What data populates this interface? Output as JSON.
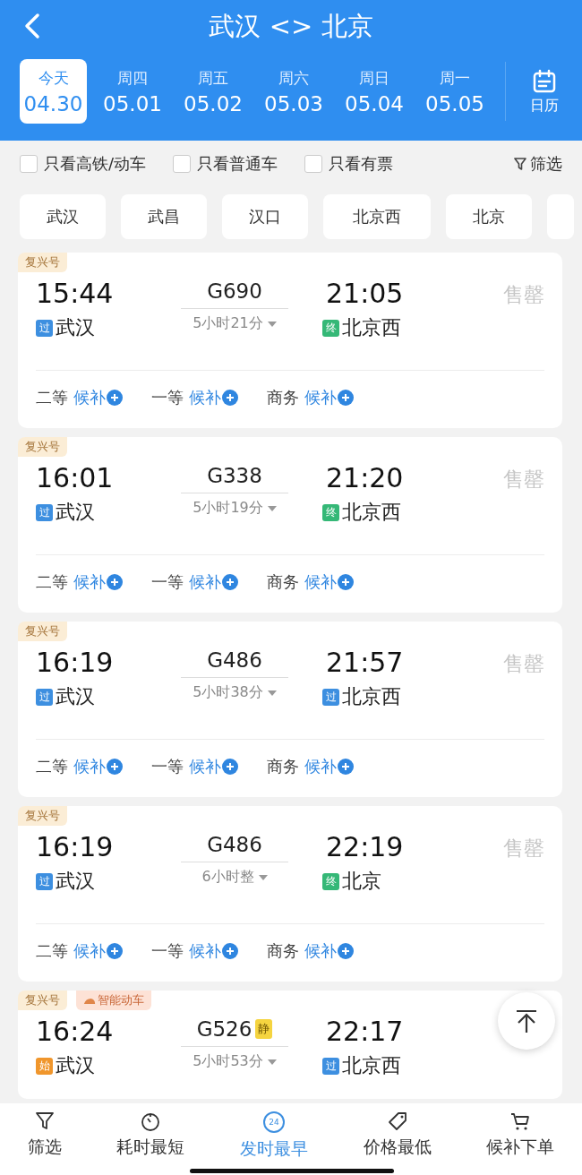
{
  "header": {
    "title": "武汉 <> 北京"
  },
  "dates": [
    {
      "weekday": "今天",
      "date": "04.30",
      "selected": true
    },
    {
      "weekday": "周四",
      "date": "05.01",
      "selected": false
    },
    {
      "weekday": "周五",
      "date": "05.02",
      "selected": false
    },
    {
      "weekday": "周六",
      "date": "05.03",
      "selected": false
    },
    {
      "weekday": "周日",
      "date": "05.04",
      "selected": false
    },
    {
      "weekday": "周一",
      "date": "05.05",
      "selected": false
    }
  ],
  "calendar": {
    "label": "日历"
  },
  "filters": [
    {
      "label": "只看高铁/动车",
      "checked": false
    },
    {
      "label": "只看普通车",
      "checked": false
    },
    {
      "label": "只看有票",
      "checked": false
    }
  ],
  "filter_button": {
    "label": "筛选"
  },
  "stations": [
    "武汉",
    "武昌",
    "汉口",
    "北京西",
    "北京"
  ],
  "trains": [
    {
      "tags": [
        {
          "label": "复兴号",
          "kind": "plain"
        }
      ],
      "depart": "15:44",
      "train": "G690",
      "arrive": "21:05",
      "from_badge": {
        "text": "过",
        "color": "#3d8fe0"
      },
      "from": "武汉",
      "duration": "5小时21分",
      "to_badge": {
        "text": "终",
        "color": "#35b877"
      },
      "to": "北京西",
      "status": "售罄",
      "seats": [
        {
          "class": "二等",
          "action": "候补"
        },
        {
          "class": "一等",
          "action": "候补"
        },
        {
          "class": "商务",
          "action": "候补"
        }
      ]
    },
    {
      "tags": [
        {
          "label": "复兴号",
          "kind": "plain"
        }
      ],
      "depart": "16:01",
      "train": "G338",
      "arrive": "21:20",
      "from_badge": {
        "text": "过",
        "color": "#3d8fe0"
      },
      "from": "武汉",
      "duration": "5小时19分",
      "to_badge": {
        "text": "终",
        "color": "#35b877"
      },
      "to": "北京西",
      "status": "售罄",
      "seats": [
        {
          "class": "二等",
          "action": "候补"
        },
        {
          "class": "一等",
          "action": "候补"
        },
        {
          "class": "商务",
          "action": "候补"
        }
      ]
    },
    {
      "tags": [
        {
          "label": "复兴号",
          "kind": "plain"
        }
      ],
      "depart": "16:19",
      "train": "G486",
      "arrive": "21:57",
      "from_badge": {
        "text": "过",
        "color": "#3d8fe0"
      },
      "from": "武汉",
      "duration": "5小时38分",
      "to_badge": {
        "text": "过",
        "color": "#3d8fe0"
      },
      "to": "北京西",
      "status": "售罄",
      "seats": [
        {
          "class": "二等",
          "action": "候补"
        },
        {
          "class": "一等",
          "action": "候补"
        },
        {
          "class": "商务",
          "action": "候补"
        }
      ]
    },
    {
      "tags": [
        {
          "label": "复兴号",
          "kind": "plain"
        }
      ],
      "depart": "16:19",
      "train": "G486",
      "arrive": "22:19",
      "from_badge": {
        "text": "过",
        "color": "#3d8fe0"
      },
      "from": "武汉",
      "duration": "6小时整",
      "to_badge": {
        "text": "终",
        "color": "#35b877"
      },
      "to": "北京",
      "status": "售罄",
      "seats": [
        {
          "class": "二等",
          "action": "候补"
        },
        {
          "class": "一等",
          "action": "候补"
        },
        {
          "class": "商务",
          "action": "候补"
        }
      ]
    },
    {
      "tags": [
        {
          "label": "复兴号",
          "kind": "plain"
        },
        {
          "label": "智能动车",
          "kind": "smart"
        }
      ],
      "depart": "16:24",
      "train": "G526",
      "quiet": "静",
      "arrive": "22:17",
      "from_badge": {
        "text": "始",
        "color": "#f0962c"
      },
      "from": "武汉",
      "duration": "5小时53分",
      "to_badge": {
        "text": "过",
        "color": "#3d8fe0"
      },
      "to": "北京西"
    }
  ],
  "bottom_nav": [
    {
      "label": "筛选",
      "selected": false
    },
    {
      "label": "耗时最短",
      "selected": false
    },
    {
      "label": "发时最早",
      "icon_text": "24",
      "selected": true
    },
    {
      "label": "价格最低",
      "selected": false
    },
    {
      "label": "候补下单",
      "selected": false
    }
  ]
}
